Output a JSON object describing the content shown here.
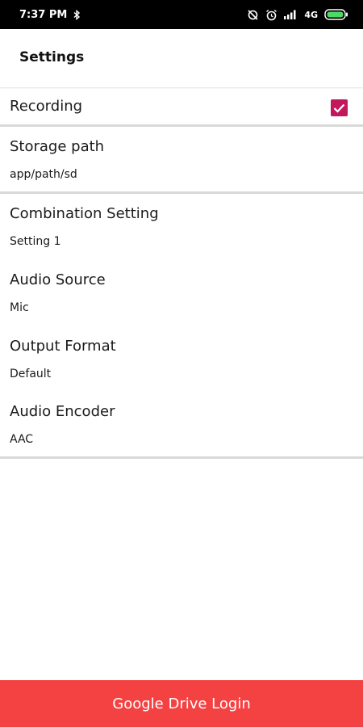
{
  "status_bar": {
    "time": "7:37 PM",
    "network": "4G",
    "icons": [
      "bluetooth-icon",
      "sync-off-icon",
      "alarm-icon",
      "signal-icon",
      "battery-icon"
    ]
  },
  "toolbar": {
    "title": "Settings"
  },
  "preferences": {
    "recording": {
      "title": "Recording",
      "checked": true
    },
    "storage_path": {
      "title": "Storage path",
      "summary": "app/path/sd"
    },
    "combination_setting": {
      "title": "Combination Setting",
      "summary": "Setting 1"
    },
    "audio_source": {
      "title": "Audio Source",
      "summary": "Mic"
    },
    "output_format": {
      "title": "Output Format",
      "summary": "Default"
    },
    "audio_encoder": {
      "title": "Audio Encoder",
      "summary": "AAC"
    }
  },
  "footer": {
    "button_label": "Google Drive Login"
  },
  "colors": {
    "accent": "#c2185b",
    "button": "#f44242",
    "status_bar": "#000000",
    "divider": "#d9d9d9"
  }
}
